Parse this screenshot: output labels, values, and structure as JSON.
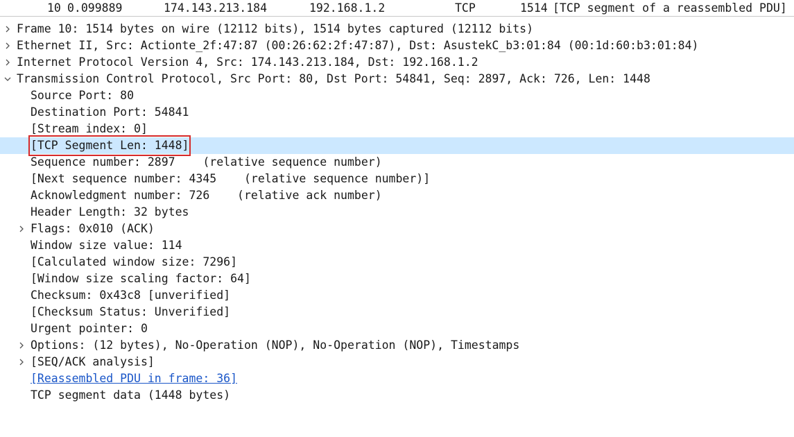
{
  "packet_row": {
    "no": "10",
    "time": "0.099889",
    "source": "174.143.213.184",
    "destination": "192.168.1.2",
    "protocol": "TCP",
    "length": "1514",
    "info": "[TCP segment of a reassembled PDU]"
  },
  "details": {
    "frame": "Frame 10: 1514 bytes on wire (12112 bits), 1514 bytes captured (12112 bits)",
    "ethernet": "Ethernet II, Src: Actionte_2f:47:87 (00:26:62:2f:47:87), Dst: AsustekC_b3:01:84 (00:1d:60:b3:01:84)",
    "ip": "Internet Protocol Version 4, Src: 174.143.213.184, Dst: 192.168.1.2",
    "tcp": "Transmission Control Protocol, Src Port: 80, Dst Port: 54841, Seq: 2897, Ack: 726, Len: 1448",
    "tcp_fields": {
      "source_port": "Source Port: 80",
      "destination_port": "Destination Port: 54841",
      "stream_index": "[Stream index: 0]",
      "segment_len": "[TCP Segment Len: 1448]",
      "sequence_number": "Sequence number: 2897    (relative sequence number)",
      "next_sequence_number": "[Next sequence number: 4345    (relative sequence number)]",
      "ack_number": "Acknowledgment number: 726    (relative ack number)",
      "header_length": "Header Length: 32 bytes",
      "flags": "Flags: 0x010 (ACK)",
      "window_size_value": "Window size value: 114",
      "calculated_window_size": "[Calculated window size: 7296]",
      "window_scaling_factor": "[Window size scaling factor: 64]",
      "checksum": "Checksum: 0x43c8 [unverified]",
      "checksum_status": "[Checksum Status: Unverified]",
      "urgent_pointer": "Urgent pointer: 0",
      "options": "Options: (12 bytes), No-Operation (NOP), No-Operation (NOP), Timestamps",
      "seq_ack_analysis": "[SEQ/ACK analysis]",
      "reassembled_pdu": "[Reassembled PDU in frame: 36]",
      "segment_data": "TCP segment data (1448 bytes)"
    }
  },
  "icons": {
    "collapsed": "chevron-right-icon",
    "expanded": "chevron-down-icon"
  },
  "colors": {
    "selected_row": "#cce8ff",
    "highlight_box": "#d62a2a",
    "link": "#1a56c8"
  }
}
